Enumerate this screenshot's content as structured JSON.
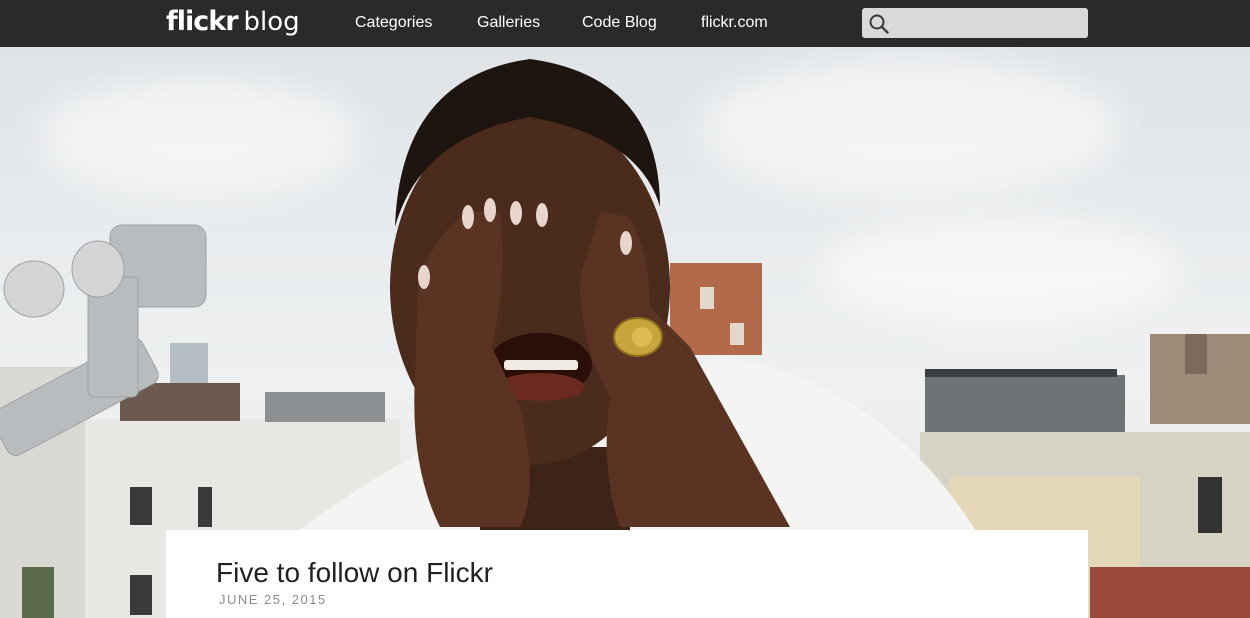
{
  "brand": {
    "name": "flickr",
    "suffix": "blog"
  },
  "nav": {
    "items": [
      {
        "label": "Categories"
      },
      {
        "label": "Galleries"
      },
      {
        "label": "Code Blog"
      },
      {
        "label": "flickr.com"
      }
    ]
  },
  "search": {
    "placeholder": "",
    "value": ""
  },
  "post": {
    "title": "Five to follow on Flickr",
    "date": "JUNE 25, 2015"
  },
  "colors": {
    "topbar": "#2a2a2a",
    "search_bg": "#d9d9d9",
    "card_bg": "#ffffff"
  },
  "icons": {
    "search": "search-icon"
  }
}
